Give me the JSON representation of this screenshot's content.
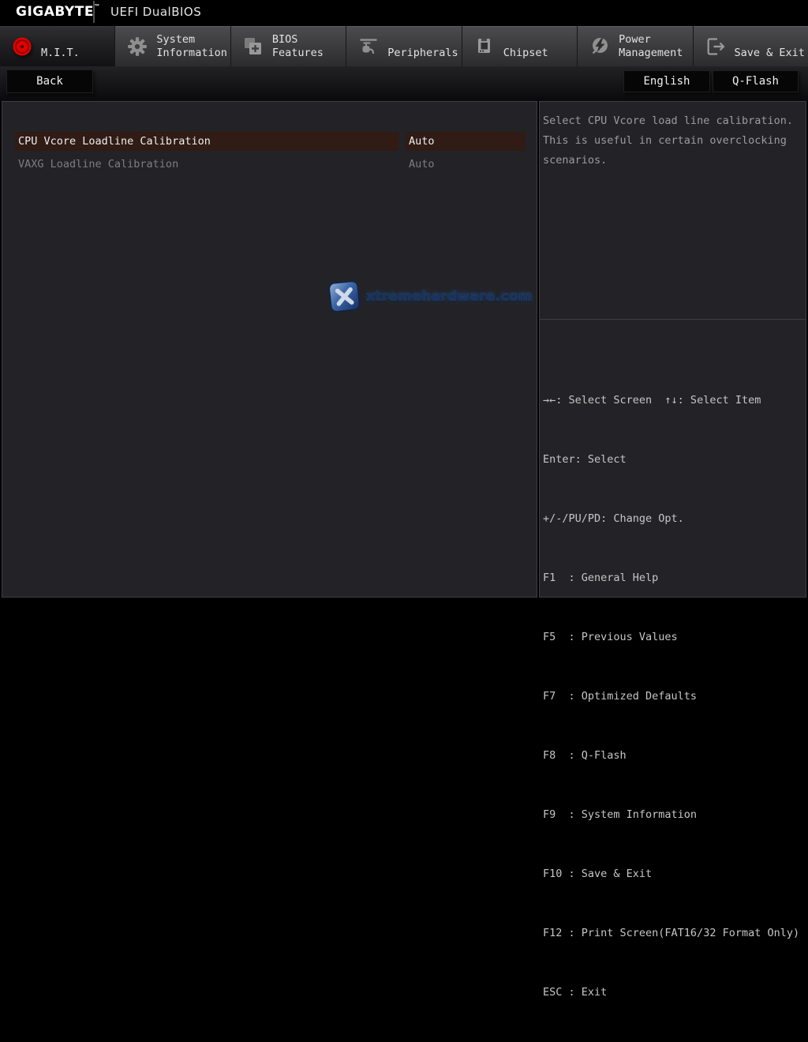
{
  "colors": {
    "accent_red": "#e30000",
    "selected_row_bg": "#301b15",
    "tab_gray": "#3a3a3c",
    "watermark_blue": "#2a5aa0"
  },
  "topbar": {
    "brand": "GIGABYTE",
    "trademark": "™",
    "title": "UEFI DualBIOS"
  },
  "tabs": [
    {
      "icon": "mit-icon",
      "line1": "M.I.T.",
      "line2": "",
      "active": true
    },
    {
      "icon": "gear-icon",
      "line1": "System",
      "line2": "Information",
      "active": false
    },
    {
      "icon": "bios-chip-icon",
      "line1": "BIOS",
      "line2": "Features",
      "active": false
    },
    {
      "icon": "peripherals-icon",
      "line1": "Peripherals",
      "line2": "",
      "active": false
    },
    {
      "icon": "chipset-icon",
      "line1": "Chipset",
      "line2": "",
      "active": false
    },
    {
      "icon": "power-icon",
      "line1": "Power",
      "line2": "Management",
      "active": false
    },
    {
      "icon": "save-exit-icon",
      "line1": "Save & Exit",
      "line2": "",
      "active": false
    }
  ],
  "toolbar": {
    "back_label": "Back",
    "language_label": "English",
    "qflash_label": "Q-Flash"
  },
  "settings": {
    "rows": [
      {
        "label": "CPU Vcore Loadline Calibration",
        "value": "Auto",
        "selected": true
      },
      {
        "label": "VAXG Loadline Calibration",
        "value": "Auto",
        "selected": false
      }
    ]
  },
  "help_panel": {
    "text": "Select CPU Vcore load line calibration. This is useful in certain overclocking scenarios."
  },
  "legend_panel": {
    "lines": [
      "→←: Select Screen  ↑↓: Select Item",
      "Enter: Select",
      "+/-/PU/PD: Change Opt.",
      "F1  : General Help",
      "F5  : Previous Values",
      "F7  : Optimized Defaults",
      "F8  : Q-Flash",
      "F9  : System Information",
      "F10 : Save & Exit",
      "F12 : Print Screen(FAT16/32 Format Only)",
      "ESC : Exit"
    ]
  },
  "watermark": {
    "text": "xtremehardware.com",
    "icon": "x-logo"
  }
}
